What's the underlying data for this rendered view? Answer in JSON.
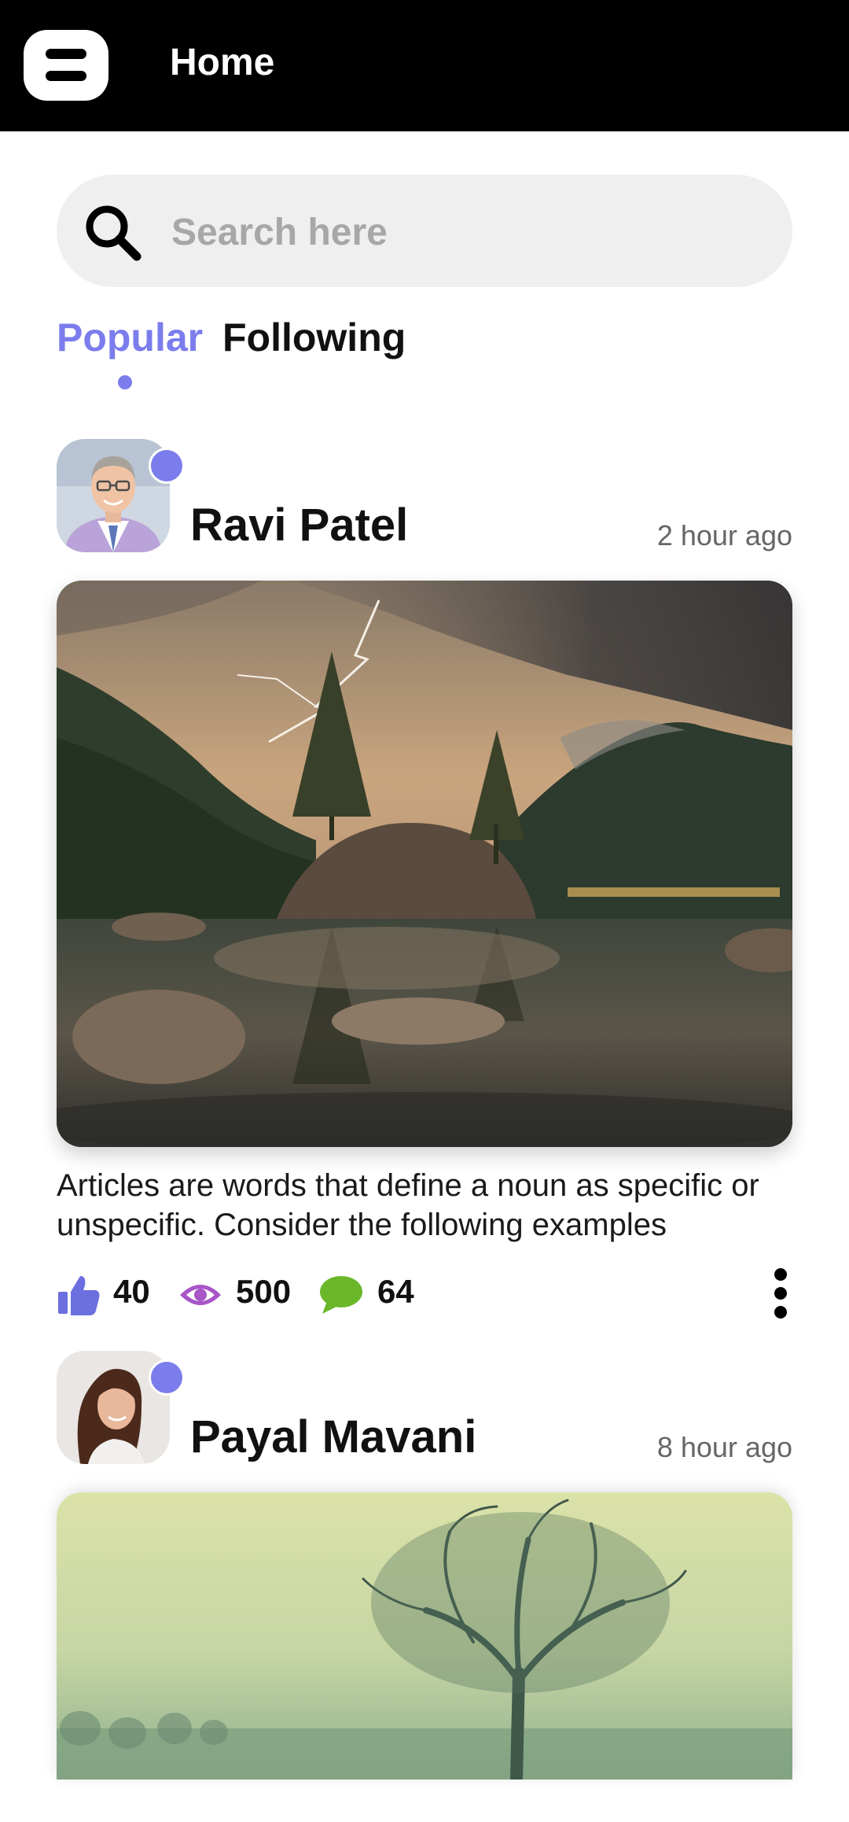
{
  "app_bar": {
    "title": "Home"
  },
  "search": {
    "placeholder": "Search here",
    "value": ""
  },
  "tabs": [
    {
      "label": "Popular",
      "active": true
    },
    {
      "label": "Following",
      "active": false
    }
  ],
  "posts": [
    {
      "author": "Ravi Patel",
      "time": "2 hour ago",
      "caption": "Articles are words that define a noun as specific or unspecific. Consider the following examples",
      "likes": "40",
      "views": "500",
      "comments": "64"
    },
    {
      "author": "Payal Mavani",
      "time": "8 hour ago"
    }
  ],
  "colors": {
    "accent": "#7b7ded",
    "like": "#6b6fe0",
    "view": "#a855c7",
    "comment": "#6ab82a"
  },
  "icons": {
    "menu": "menu-icon",
    "search": "search-icon",
    "like": "thumbs-up-icon",
    "views": "eye-icon",
    "comments": "speech-bubble-icon",
    "more": "more-vertical-icon"
  }
}
